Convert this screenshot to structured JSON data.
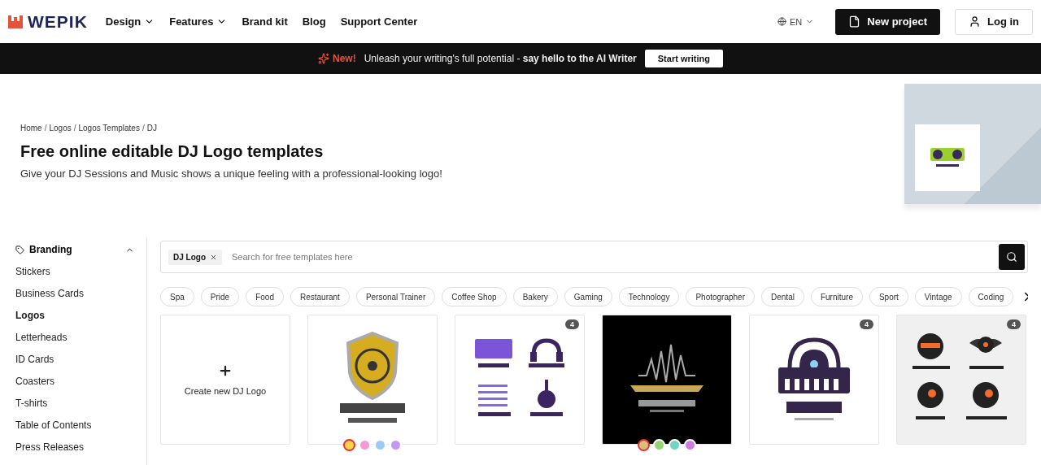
{
  "header": {
    "logo": "WEPIK",
    "nav": [
      {
        "label": "Design",
        "dropdown": true
      },
      {
        "label": "Features",
        "dropdown": true
      },
      {
        "label": "Brand kit",
        "dropdown": false
      },
      {
        "label": "Blog",
        "dropdown": false
      },
      {
        "label": "Support Center",
        "dropdown": false
      }
    ],
    "language": "EN",
    "new_project": "New project",
    "login": "Log in"
  },
  "banner": {
    "badge": "New!",
    "text": "Unleash your writing's full potential - ",
    "bold": "say hello to the AI Writer",
    "button": "Start writing"
  },
  "hero": {
    "breadcrumb": [
      "Home",
      "Logos",
      "Logos Templates",
      "DJ"
    ],
    "separator": "/",
    "title": "Free online editable DJ Logo templates",
    "subtitle": "Give your DJ Sessions and Music shows a unique feeling with a professional-looking logo!"
  },
  "sidebar": {
    "section": "Branding",
    "expanded": true,
    "items": [
      {
        "label": "Stickers",
        "selected": false
      },
      {
        "label": "Business Cards",
        "selected": false
      },
      {
        "label": "Logos",
        "selected": true
      },
      {
        "label": "Letterheads",
        "selected": false
      },
      {
        "label": "ID Cards",
        "selected": false
      },
      {
        "label": "Coasters",
        "selected": false
      },
      {
        "label": "T-shirts",
        "selected": false
      },
      {
        "label": "Table of Contents",
        "selected": false
      },
      {
        "label": "Press Releases",
        "selected": false
      }
    ]
  },
  "search": {
    "tag": "DJ Logo",
    "placeholder": "Search for free templates here"
  },
  "chips": [
    "Spa",
    "Pride",
    "Food",
    "Restaurant",
    "Personal Trainer",
    "Coffee Shop",
    "Bakery",
    "Gaming",
    "Technology",
    "Photographer",
    "Dental",
    "Furniture",
    "Sport",
    "Vintage",
    "Coding"
  ],
  "cards": [
    {
      "kind": "create",
      "label": "Create new DJ Logo"
    },
    {
      "kind": "shield",
      "swatches": [
        {
          "color": "#f5d547",
          "selected": true
        },
        {
          "color": "#f49ad6",
          "selected": false
        },
        {
          "color": "#9ec8f7",
          "selected": false
        },
        {
          "color": "#c398f2",
          "selected": false
        }
      ]
    },
    {
      "kind": "grid",
      "badge": "4"
    },
    {
      "kind": "wave",
      "swatches": [
        {
          "color": "#d8c07a",
          "selected": true
        },
        {
          "color": "#97d477",
          "selected": false
        },
        {
          "color": "#72d4c2",
          "selected": false
        },
        {
          "color": "#cc7ee0",
          "selected": false
        }
      ]
    },
    {
      "kind": "keyboard",
      "badge": "4"
    },
    {
      "kind": "faces",
      "badge": "4"
    }
  ]
}
